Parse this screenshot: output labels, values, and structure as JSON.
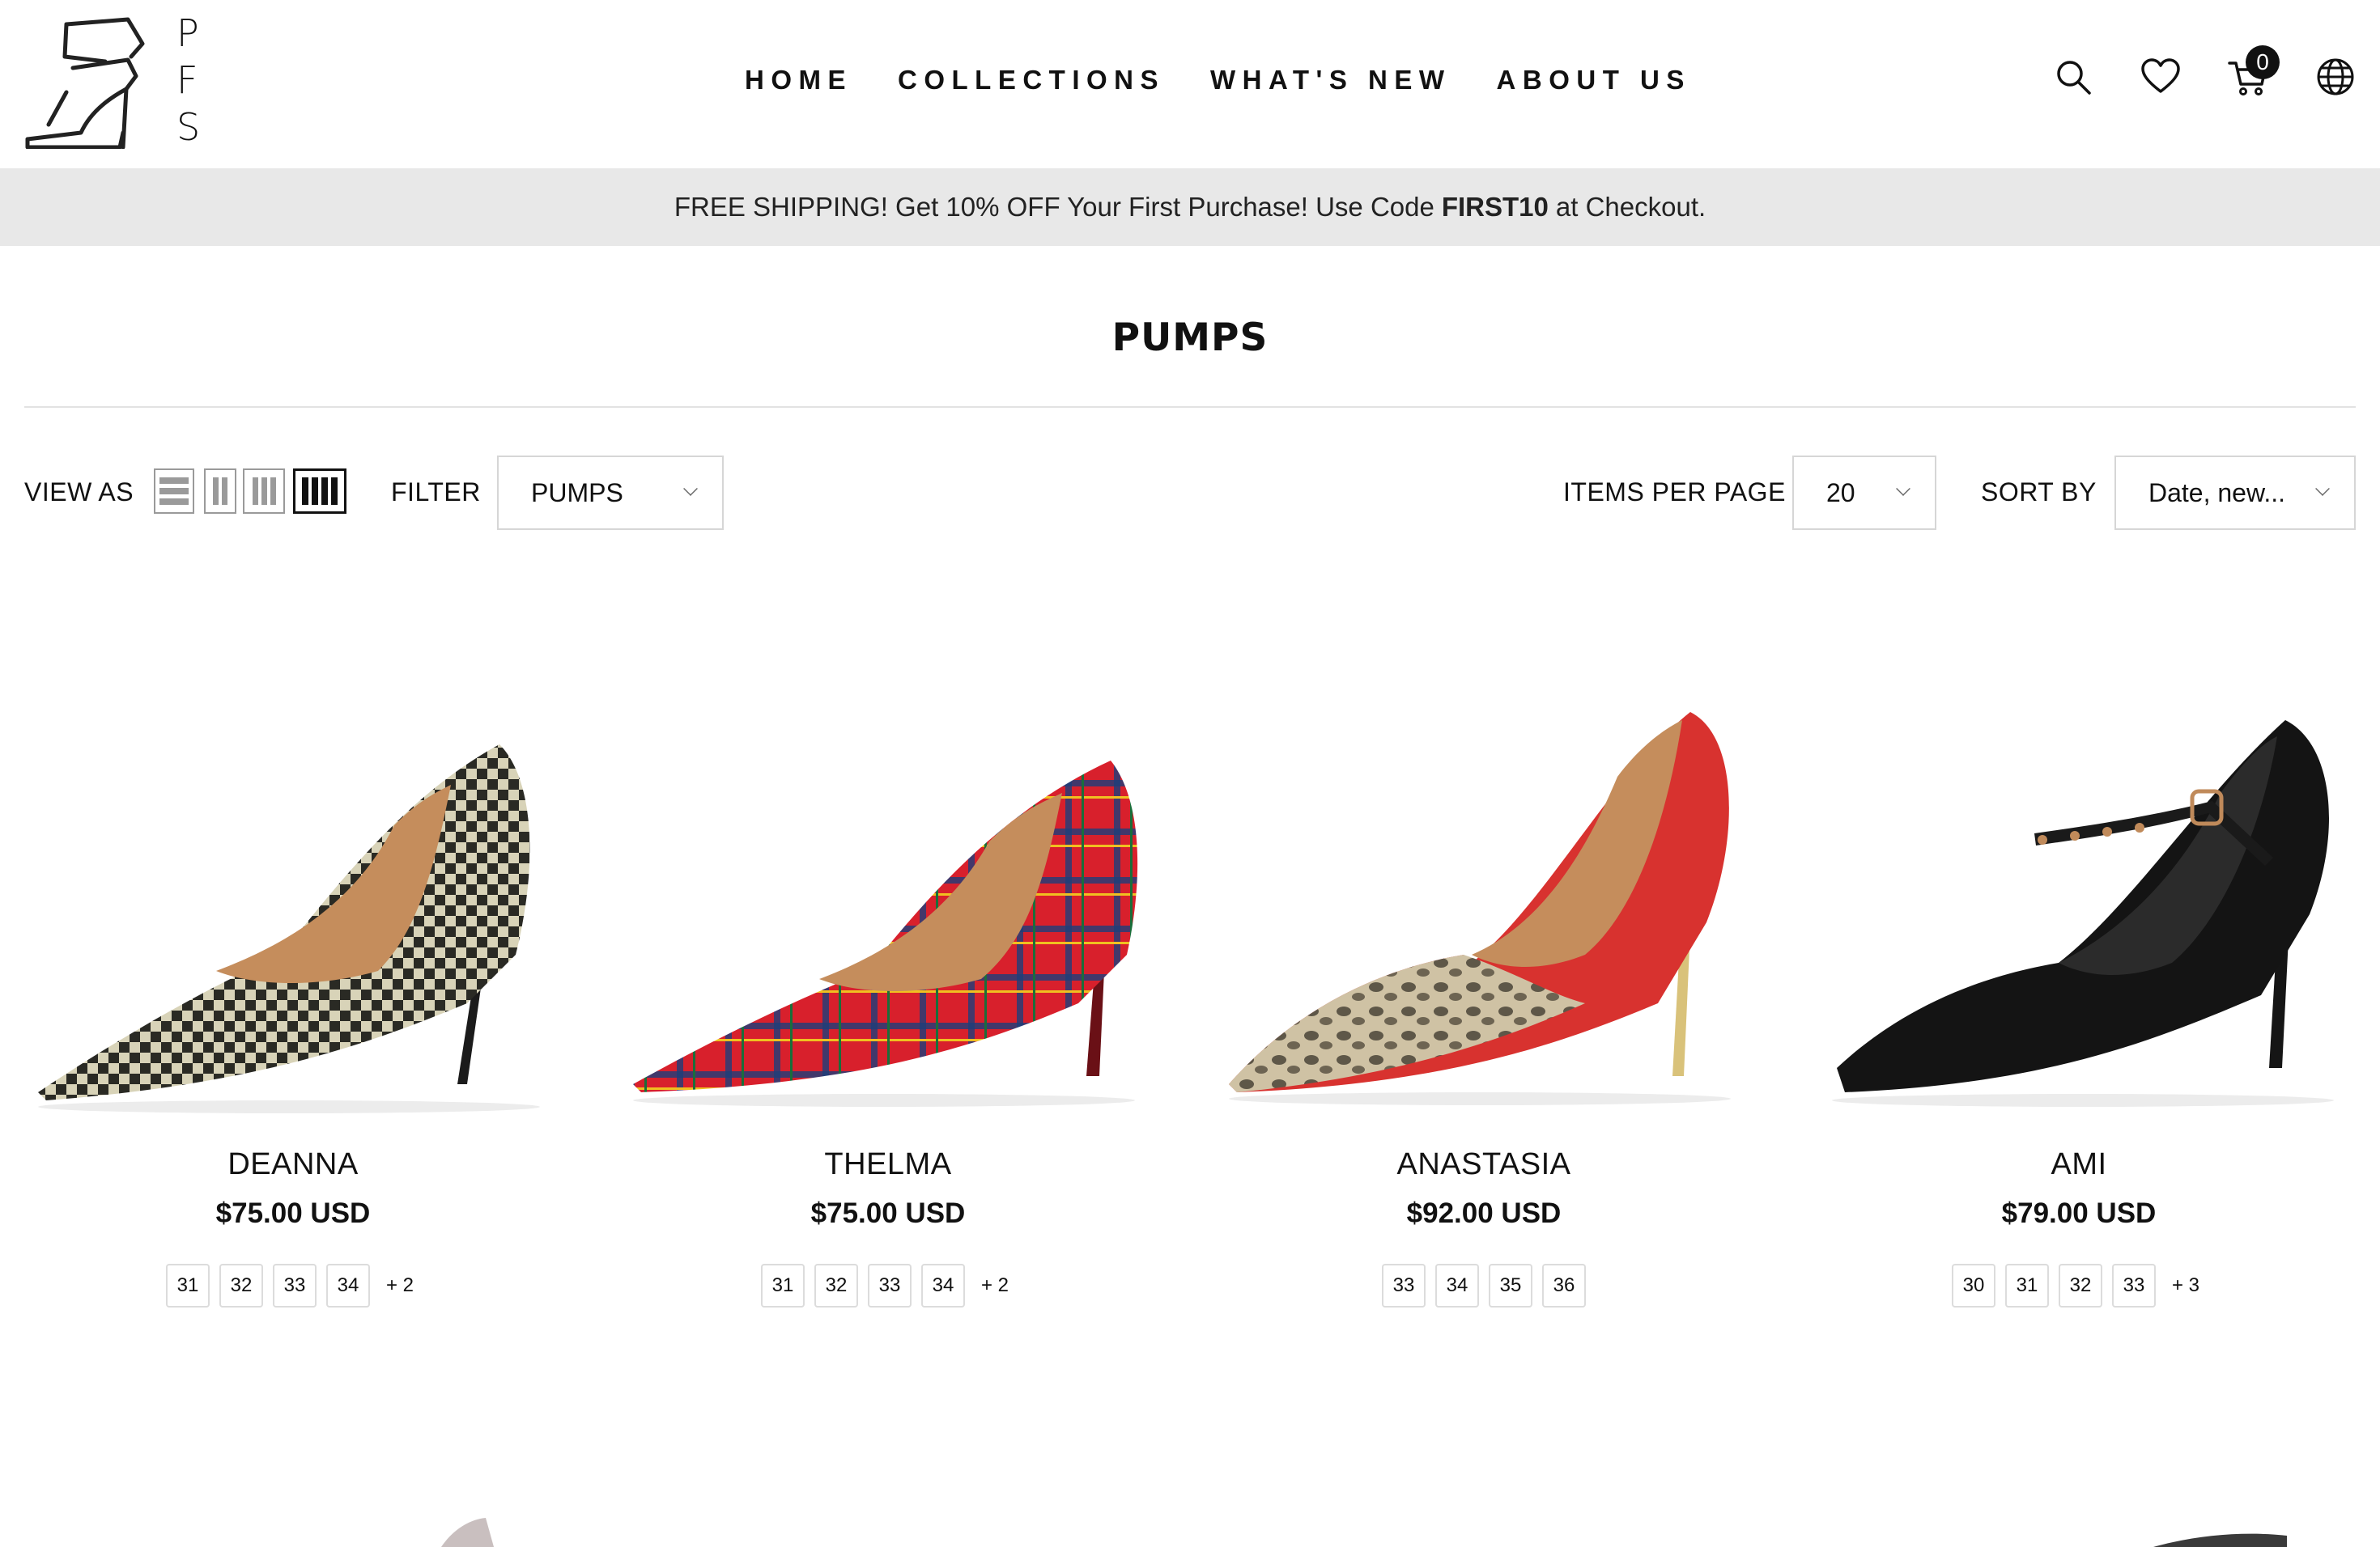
{
  "header": {
    "logo_letters": [
      "P",
      "F",
      "S"
    ],
    "nav": [
      "HOME",
      "COLLECTIONS",
      "WHAT'S NEW",
      "ABOUT US"
    ],
    "icons": [
      "search-icon",
      "heart-icon",
      "cart-icon",
      "globe-icon"
    ],
    "cart_count": "0"
  },
  "banner": {
    "text_before": "FREE SHIPPING! Get 10% OFF Your First Purchase! Use Code",
    "code": "FIRST10",
    "text_after": "at Checkout."
  },
  "page_title": "PUMPS",
  "toolbar": {
    "view_as_label": "VIEW AS",
    "filter_label": "FILTER",
    "filter_value": "PUMPS",
    "items_per_page_label": "ITEMS PER PAGE",
    "items_per_page_value": "20",
    "sort_by_label": "SORT BY",
    "sort_by_value": "Date, new..."
  },
  "products": [
    {
      "name": "DEANNA",
      "price": "$75.00 USD",
      "sizes": [
        "31",
        "32",
        "33",
        "34"
      ],
      "more": "+ 2",
      "colors": {
        "upper": "#2a2a24",
        "accent": "#d8d3b8"
      }
    },
    {
      "name": "THELMA",
      "price": "$75.00 USD",
      "sizes": [
        "31",
        "32",
        "33",
        "34"
      ],
      "more": "+ 2",
      "colors": {
        "upper": "#d8202c",
        "accent": "#1d3f7a"
      }
    },
    {
      "name": "ANASTASIA",
      "price": "$92.00 USD",
      "sizes": [
        "33",
        "34",
        "35",
        "36"
      ],
      "more": "",
      "colors": {
        "upper": "#d8322f",
        "accent": "#b9ab8e"
      }
    },
    {
      "name": "AMI",
      "price": "$79.00 USD",
      "sizes": [
        "30",
        "31",
        "32",
        "33"
      ],
      "more": "+ 3",
      "colors": {
        "upper": "#141414",
        "accent": "#c08a5a"
      }
    }
  ]
}
